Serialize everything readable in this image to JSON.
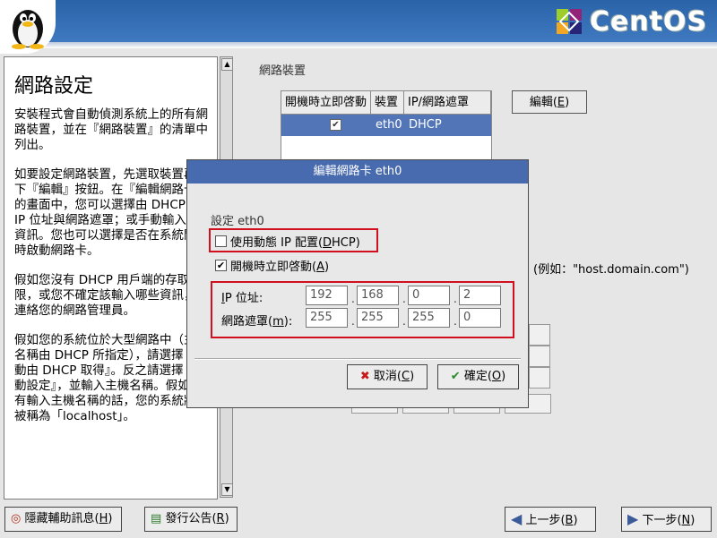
{
  "brand": {
    "name": "CentOS"
  },
  "help": {
    "title": "網路設定",
    "paragraphs": [
      "安裝程式會自動偵測系統上的所有網路裝置，並在『網路裝置』的清單中列出。",
      "如要設定網路裝置，先選取裝置再按下『編輯』按鈕。在『編輯網路卡』的畫面中，您可以選擇由 DHCP 決定 IP 位址與網路遮罩；或手動輸入這些資訊。您也可以選擇是否在系統開機時啟動網路卡。",
      "假如您沒有 DHCP 用戶端的存取權限，或您不確定該輸入哪些資訊，請連絡您的網路管理員。",
      "假如您的系統位於大型網路中（主機名稱由 DHCP 所指定），請選擇『自動由 DHCP 取得』。反之請選擇『手動設定』，並輸入主機名稱。假如您沒有輸入主機名稱的話，您的系統將會被稱為「localhost」。"
    ]
  },
  "devices": {
    "label": "網路裝置",
    "columns": [
      "開機時立即啓動",
      "裝置",
      "IP/網路遮罩"
    ],
    "rows": [
      {
        "active": "✔",
        "device": "eth0",
        "ip": "DHCP"
      }
    ],
    "edit_button": "編輯(",
    "edit_key": "E"
  },
  "hostname_hint": "(例如：\"host.domain.com\")",
  "dialog": {
    "title": "編輯網路卡 eth0",
    "config_label": "設定 eth0",
    "dhcp_label": "使用動態 IP 配置(",
    "dhcp_key": "D",
    "dhcp_rest": "HCP)",
    "dhcp_checked": false,
    "onboot_label": "開機時立即啓動(",
    "onboot_key": "A",
    "onboot_checked": true,
    "ip_key": "I",
    "ip_label_rest": "P 位址:",
    "mask_label": "網路遮罩(",
    "mask_key": "m",
    "ip": [
      "192",
      "168",
      "0",
      "2"
    ],
    "mask": [
      "255",
      "255",
      "255",
      "0"
    ],
    "cancel": "取消(",
    "cancel_key": "C",
    "ok": "確定(",
    "ok_key": "O"
  },
  "bottom": {
    "hide_help": "隱藏輔助訊息(",
    "hide_help_key": "H",
    "release_notes": "發行公告(",
    "release_notes_key": "R",
    "back": "上一步(",
    "back_key": "B",
    "next": "下一步(",
    "next_key": "N"
  },
  "colors": {
    "header": "#2a63a8",
    "selection": "#5275b8",
    "highlight": "#d0101e"
  }
}
